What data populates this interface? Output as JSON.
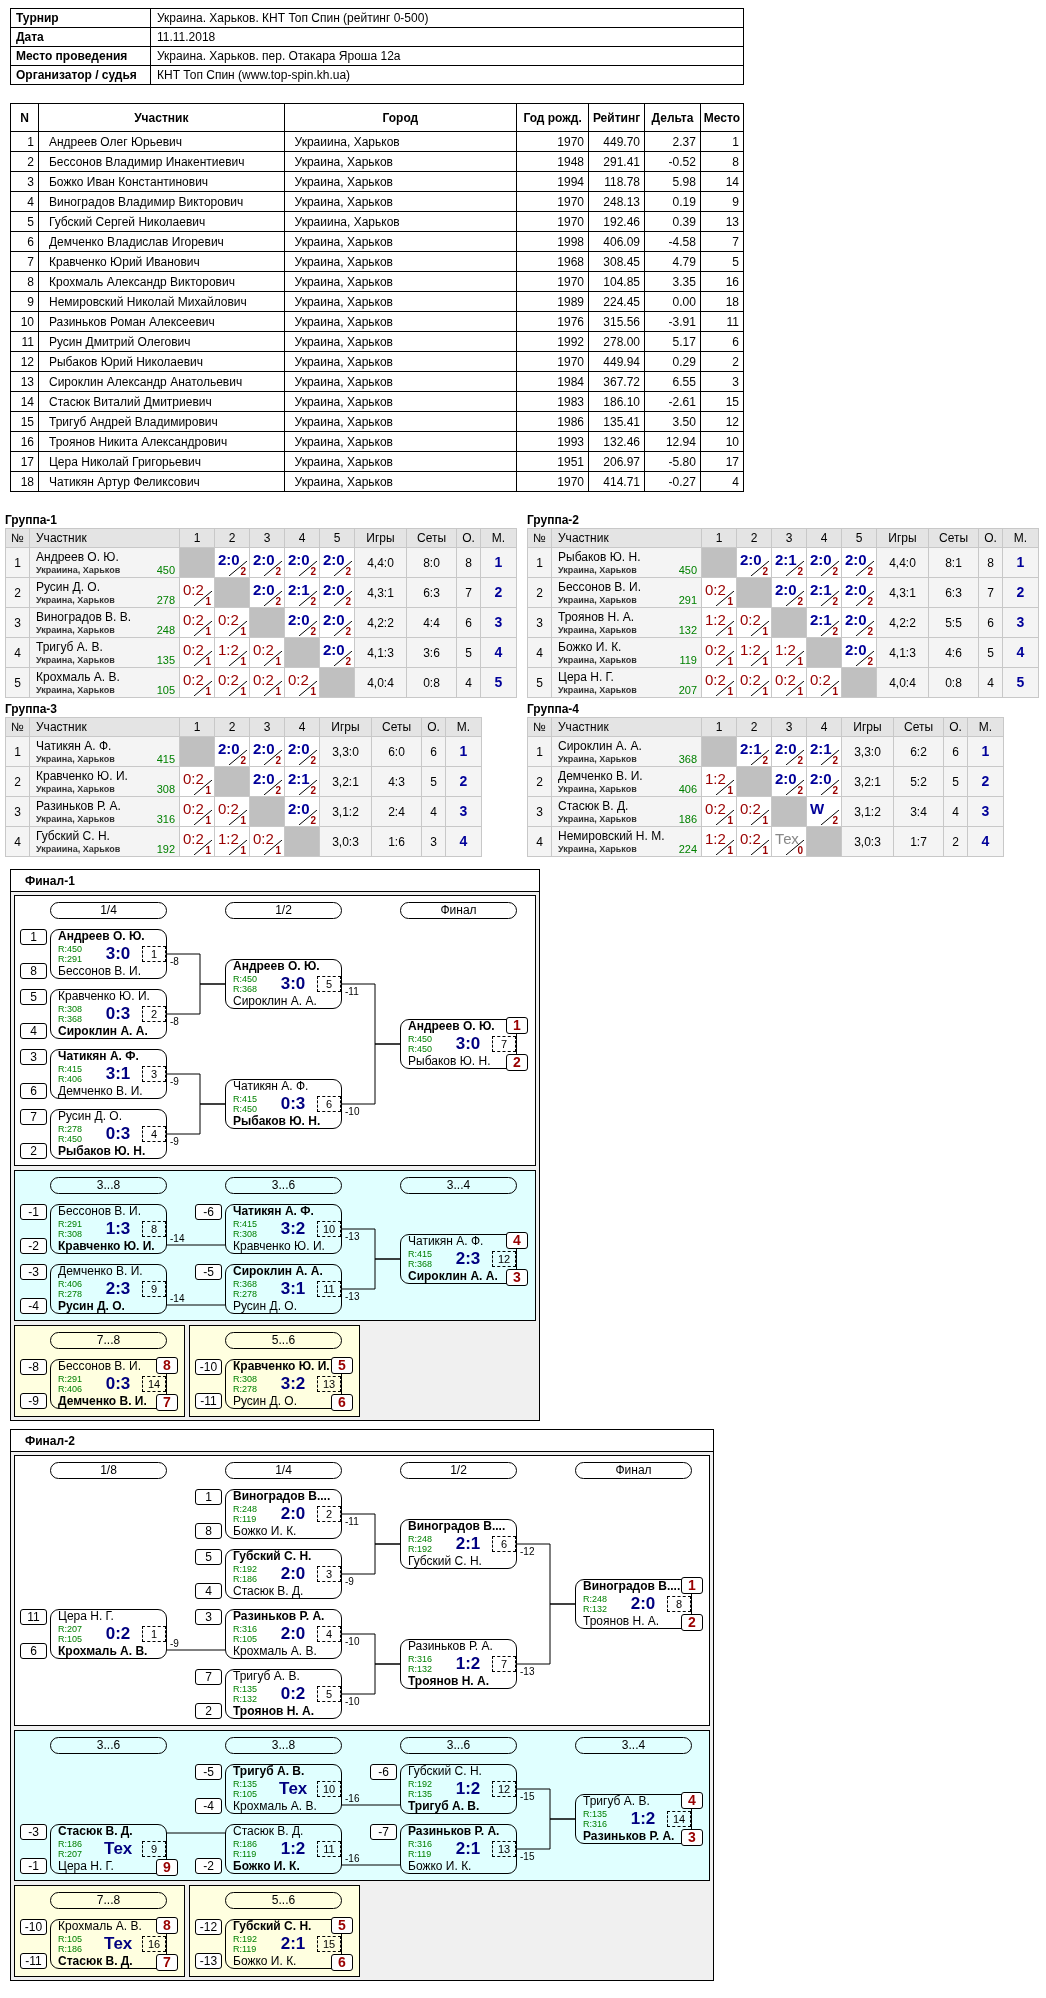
{
  "tournament": [
    {
      "label": "Турнир",
      "value": "Украина. Харьков. КНТ Топ Спин (рейтинг 0-500)"
    },
    {
      "label": "Дата",
      "value": "11.11.2018"
    },
    {
      "label": "Место проведения",
      "value": "Украина. Харьков. пер. Отакара Яроша 12а"
    },
    {
      "label": "Организатор / судья",
      "value": "КНТ Топ Спин (www.top-spin.kh.ua)"
    }
  ],
  "participants": {
    "columns": [
      "N",
      "Участник",
      "Город",
      "Год рожд.",
      "Рейтинг",
      "Дельта",
      "Место"
    ],
    "rows": [
      {
        "n": "1",
        "name": "Андреев Олег Юрьевич",
        "city": "Украиина, Харьков",
        "year": "1970",
        "rating": "449.70",
        "delta": "2.37",
        "place": "1"
      },
      {
        "n": "2",
        "name": "Бессонов Владимир Инакентиевич",
        "city": "Украина, Харьков",
        "year": "1948",
        "rating": "291.41",
        "delta": "-0.52",
        "place": "8"
      },
      {
        "n": "3",
        "name": "Божко Иван Константинович",
        "city": "Украина, Харьков",
        "year": "1994",
        "rating": "118.78",
        "delta": "5.98",
        "place": "14"
      },
      {
        "n": "4",
        "name": "Виноградов Владимир Викторович",
        "city": "Украина, Харьков",
        "year": "1970",
        "rating": "248.13",
        "delta": "0.19",
        "place": "9"
      },
      {
        "n": "5",
        "name": "Губский Сергей Николаевич",
        "city": "Украиина, Харьков",
        "year": "1970",
        "rating": "192.46",
        "delta": "0.39",
        "place": "13"
      },
      {
        "n": "6",
        "name": "Демченко Владислав Игоревич",
        "city": "Украина, Харьков",
        "year": "1998",
        "rating": "406.09",
        "delta": "-4.58",
        "place": "7"
      },
      {
        "n": "7",
        "name": "Кравченко Юрий Иванович",
        "city": "Украина, Харьков",
        "year": "1968",
        "rating": "308.45",
        "delta": "4.79",
        "place": "5"
      },
      {
        "n": "8",
        "name": "Крохмаль Александр Викторович",
        "city": "Украина, Харьков",
        "year": "1970",
        "rating": "104.85",
        "delta": "3.35",
        "place": "16"
      },
      {
        "n": "9",
        "name": "Немировский Николай Михайлович",
        "city": "Украина, Харьков",
        "year": "1989",
        "rating": "224.45",
        "delta": "0.00",
        "place": "18"
      },
      {
        "n": "10",
        "name": "Разиньков Роман Алексеевич",
        "city": "Украина, Харьков",
        "year": "1976",
        "rating": "315.56",
        "delta": "-3.91",
        "place": "11"
      },
      {
        "n": "11",
        "name": "Русин Дмитрий Олегович",
        "city": "Украина, Харьков",
        "year": "1992",
        "rating": "278.00",
        "delta": "5.17",
        "place": "6"
      },
      {
        "n": "12",
        "name": "Рыбаков Юрий Николаевич",
        "city": "Украина, Харьков",
        "year": "1970",
        "rating": "449.94",
        "delta": "0.29",
        "place": "2"
      },
      {
        "n": "13",
        "name": "Сироклин Александр Анатольевич",
        "city": "Украина, Харьков",
        "year": "1984",
        "rating": "367.72",
        "delta": "6.55",
        "place": "3"
      },
      {
        "n": "14",
        "name": "Стасюк Виталий Дмитриевич",
        "city": "Украина, Харьков",
        "year": "1983",
        "rating": "186.10",
        "delta": "-2.61",
        "place": "15"
      },
      {
        "n": "15",
        "name": "Тригуб Андрей Владимирович",
        "city": "Украина, Харьков",
        "year": "1986",
        "rating": "135.41",
        "delta": "3.50",
        "place": "12"
      },
      {
        "n": "16",
        "name": "Троянов Никита Александрович",
        "city": "Украина, Харьков",
        "year": "1993",
        "rating": "132.46",
        "delta": "12.94",
        "place": "10"
      },
      {
        "n": "17",
        "name": "Цера Николай Григорьевич",
        "city": "Украина, Харьков",
        "year": "1951",
        "rating": "206.97",
        "delta": "-5.80",
        "place": "17"
      },
      {
        "n": "18",
        "name": "Чатикян Артур Феликсович",
        "city": "Украина, Харьков",
        "year": "1970",
        "rating": "414.71",
        "delta": "-0.27",
        "place": "4"
      }
    ]
  },
  "groups": [
    {
      "title": "Группа-1",
      "columns": [
        "№",
        "Участник",
        "1",
        "2",
        "3",
        "4",
        "5",
        "Игры",
        "Сеты",
        "О.",
        "М."
      ],
      "rows": [
        {
          "n": "1",
          "name": "Андреев О. Ю.",
          "city": "Украиина, Харьков",
          "rating": "450",
          "results": [
            {
              "kind": "self"
            },
            {
              "kind": "win",
              "score": "2:0",
              "points": "2"
            },
            {
              "kind": "win",
              "score": "2:0",
              "points": "2"
            },
            {
              "kind": "win",
              "score": "2:0",
              "points": "2"
            },
            {
              "kind": "win",
              "score": "2:0",
              "points": "2"
            }
          ],
          "games": "4,4:0",
          "sets": "8:0",
          "points": "8",
          "place": "1"
        },
        {
          "n": "2",
          "name": "Русин Д. О.",
          "city": "Украина, Харьков",
          "rating": "278",
          "results": [
            {
              "kind": "loss",
              "score": "0:2",
              "points": "1"
            },
            {
              "kind": "self"
            },
            {
              "kind": "win",
              "score": "2:0",
              "points": "2"
            },
            {
              "kind": "win",
              "score": "2:1",
              "points": "2"
            },
            {
              "kind": "win",
              "score": "2:0",
              "points": "2"
            }
          ],
          "games": "4,3:1",
          "sets": "6:3",
          "points": "7",
          "place": "2"
        },
        {
          "n": "3",
          "name": "Виноградов В. В.",
          "city": "Украина, Харьков",
          "rating": "248",
          "results": [
            {
              "kind": "loss",
              "score": "0:2",
              "points": "1"
            },
            {
              "kind": "loss",
              "score": "0:2",
              "points": "1"
            },
            {
              "kind": "self"
            },
            {
              "kind": "win",
              "score": "2:0",
              "points": "2"
            },
            {
              "kind": "win",
              "score": "2:0",
              "points": "2"
            }
          ],
          "games": "4,2:2",
          "sets": "4:4",
          "points": "6",
          "place": "3"
        },
        {
          "n": "4",
          "name": "Тригуб А. В.",
          "city": "Украина, Харьков",
          "rating": "135",
          "results": [
            {
              "kind": "loss",
              "score": "0:2",
              "points": "1"
            },
            {
              "kind": "loss",
              "score": "1:2",
              "points": "1"
            },
            {
              "kind": "loss",
              "score": "0:2",
              "points": "1"
            },
            {
              "kind": "self"
            },
            {
              "kind": "win",
              "score": "2:0",
              "points": "2"
            }
          ],
          "games": "4,1:3",
          "sets": "3:6",
          "points": "5",
          "place": "4"
        },
        {
          "n": "5",
          "name": "Крохмаль А. В.",
          "city": "Украина, Харьков",
          "rating": "105",
          "results": [
            {
              "kind": "loss",
              "score": "0:2",
              "points": "1"
            },
            {
              "kind": "loss",
              "score": "0:2",
              "points": "1"
            },
            {
              "kind": "loss",
              "score": "0:2",
              "points": "1"
            },
            {
              "kind": "loss",
              "score": "0:2",
              "points": "1"
            },
            {
              "kind": "self"
            }
          ],
          "games": "4,0:4",
          "sets": "0:8",
          "points": "4",
          "place": "5"
        }
      ]
    },
    {
      "title": "Группа-2",
      "columns": [
        "№",
        "Участник",
        "1",
        "2",
        "3",
        "4",
        "5",
        "Игры",
        "Сеты",
        "О.",
        "М."
      ],
      "rows": [
        {
          "n": "1",
          "name": "Рыбаков Ю. Н.",
          "city": "Украина, Харьков",
          "rating": "450",
          "results": [
            {
              "kind": "self"
            },
            {
              "kind": "win",
              "score": "2:0",
              "points": "2"
            },
            {
              "kind": "win",
              "score": "2:1",
              "points": "2"
            },
            {
              "kind": "win",
              "score": "2:0",
              "points": "2"
            },
            {
              "kind": "win",
              "score": "2:0",
              "points": "2"
            }
          ],
          "games": "4,4:0",
          "sets": "8:1",
          "points": "8",
          "place": "1"
        },
        {
          "n": "2",
          "name": "Бессонов В. И.",
          "city": "Украина, Харьков",
          "rating": "291",
          "results": [
            {
              "kind": "loss",
              "score": "0:2",
              "points": "1"
            },
            {
              "kind": "self"
            },
            {
              "kind": "win",
              "score": "2:0",
              "points": "2"
            },
            {
              "kind": "win",
              "score": "2:1",
              "points": "2"
            },
            {
              "kind": "win",
              "score": "2:0",
              "points": "2"
            }
          ],
          "games": "4,3:1",
          "sets": "6:3",
          "points": "7",
          "place": "2"
        },
        {
          "n": "3",
          "name": "Троянов Н. А.",
          "city": "Украина, Харьков",
          "rating": "132",
          "results": [
            {
              "kind": "loss",
              "score": "1:2",
              "points": "1"
            },
            {
              "kind": "loss",
              "score": "0:2",
              "points": "1"
            },
            {
              "kind": "self"
            },
            {
              "kind": "win",
              "score": "2:1",
              "points": "2"
            },
            {
              "kind": "win",
              "score": "2:0",
              "points": "2"
            }
          ],
          "games": "4,2:2",
          "sets": "5:5",
          "points": "6",
          "place": "3"
        },
        {
          "n": "4",
          "name": "Божко И. К.",
          "city": "Украина, Харьков",
          "rating": "119",
          "results": [
            {
              "kind": "loss",
              "score": "0:2",
              "points": "1"
            },
            {
              "kind": "loss",
              "score": "1:2",
              "points": "1"
            },
            {
              "kind": "loss",
              "score": "1:2",
              "points": "1"
            },
            {
              "kind": "self"
            },
            {
              "kind": "win",
              "score": "2:0",
              "points": "2"
            }
          ],
          "games": "4,1:3",
          "sets": "4:6",
          "points": "5",
          "place": "4"
        },
        {
          "n": "5",
          "name": "Цера Н. Г.",
          "city": "Украина, Харьков",
          "rating": "207",
          "results": [
            {
              "kind": "loss",
              "score": "0:2",
              "points": "1"
            },
            {
              "kind": "loss",
              "score": "0:2",
              "points": "1"
            },
            {
              "kind": "loss",
              "score": "0:2",
              "points": "1"
            },
            {
              "kind": "loss",
              "score": "0:2",
              "points": "1"
            },
            {
              "kind": "self"
            }
          ],
          "games": "4,0:4",
          "sets": "0:8",
          "points": "4",
          "place": "5"
        }
      ]
    },
    {
      "title": "Группа-3",
      "columns": [
        "№",
        "Участник",
        "1",
        "2",
        "3",
        "4",
        "Игры",
        "Сеты",
        "О.",
        "М."
      ],
      "rows": [
        {
          "n": "1",
          "name": "Чатикян А. Ф.",
          "city": "Украина, Харьков",
          "rating": "415",
          "results": [
            {
              "kind": "self"
            },
            {
              "kind": "win",
              "score": "2:0",
              "points": "2"
            },
            {
              "kind": "win",
              "score": "2:0",
              "points": "2"
            },
            {
              "kind": "win",
              "score": "2:0",
              "points": "2"
            }
          ],
          "games": "3,3:0",
          "sets": "6:0",
          "points": "6",
          "place": "1"
        },
        {
          "n": "2",
          "name": "Кравченко Ю. И.",
          "city": "Украина, Харьков",
          "rating": "308",
          "results": [
            {
              "kind": "loss",
              "score": "0:2",
              "points": "1"
            },
            {
              "kind": "self"
            },
            {
              "kind": "win",
              "score": "2:0",
              "points": "2"
            },
            {
              "kind": "win",
              "score": "2:1",
              "points": "2"
            }
          ],
          "games": "3,2:1",
          "sets": "4:3",
          "points": "5",
          "place": "2"
        },
        {
          "n": "3",
          "name": "Разиньков Р. А.",
          "city": "Украина, Харьков",
          "rating": "316",
          "results": [
            {
              "kind": "loss",
              "score": "0:2",
              "points": "1"
            },
            {
              "kind": "loss",
              "score": "0:2",
              "points": "1"
            },
            {
              "kind": "self"
            },
            {
              "kind": "win",
              "score": "2:0",
              "points": "2"
            }
          ],
          "games": "3,1:2",
          "sets": "2:4",
          "points": "4",
          "place": "3"
        },
        {
          "n": "4",
          "name": "Губский С. Н.",
          "city": "Украиина, Харьков",
          "rating": "192",
          "results": [
            {
              "kind": "loss",
              "score": "0:2",
              "points": "1"
            },
            {
              "kind": "loss",
              "score": "1:2",
              "points": "1"
            },
            {
              "kind": "loss",
              "score": "0:2",
              "points": "1"
            },
            {
              "kind": "self"
            }
          ],
          "games": "3,0:3",
          "sets": "1:6",
          "points": "3",
          "place": "4"
        }
      ]
    },
    {
      "title": "Группа-4",
      "columns": [
        "№",
        "Участник",
        "1",
        "2",
        "3",
        "4",
        "Игры",
        "Сеты",
        "О.",
        "М."
      ],
      "rows": [
        {
          "n": "1",
          "name": "Сироклин А. А.",
          "city": "Украина, Харьков",
          "rating": "368",
          "results": [
            {
              "kind": "self"
            },
            {
              "kind": "win",
              "score": "2:1",
              "points": "2"
            },
            {
              "kind": "win",
              "score": "2:0",
              "points": "2"
            },
            {
              "kind": "win",
              "score": "2:1",
              "points": "2"
            }
          ],
          "games": "3,3:0",
          "sets": "6:2",
          "points": "6",
          "place": "1"
        },
        {
          "n": "2",
          "name": "Демченко В. И.",
          "city": "Украина, Харьков",
          "rating": "406",
          "results": [
            {
              "kind": "loss",
              "score": "1:2",
              "points": "1"
            },
            {
              "kind": "self"
            },
            {
              "kind": "win",
              "score": "2:0",
              "points": "2"
            },
            {
              "kind": "win",
              "score": "2:0",
              "points": "2"
            }
          ],
          "games": "3,2:1",
          "sets": "5:2",
          "points": "5",
          "place": "2"
        },
        {
          "n": "3",
          "name": "Стасюк В. Д.",
          "city": "Украина, Харьков",
          "rating": "186",
          "results": [
            {
              "kind": "loss",
              "score": "0:2",
              "points": "1"
            },
            {
              "kind": "loss",
              "score": "0:2",
              "points": "1"
            },
            {
              "kind": "self"
            },
            {
              "kind": "win",
              "score": "W",
              "points": "2"
            }
          ],
          "games": "3,1:2",
          "sets": "3:4",
          "points": "4",
          "place": "3"
        },
        {
          "n": "4",
          "name": "Немировский Н. М.",
          "city": "Украина, Харьков",
          "rating": "224",
          "results": [
            {
              "kind": "loss",
              "score": "1:2",
              "points": "1"
            },
            {
              "kind": "loss",
              "score": "0:2",
              "points": "1"
            },
            {
              "kind": "tech",
              "score": "Тех",
              "points": "0"
            },
            {
              "kind": "self"
            }
          ],
          "games": "3,0:3",
          "sets": "1:7",
          "points": "2",
          "place": "4"
        }
      ]
    }
  ],
  "finals": [
    {
      "title": "Финал-1",
      "sections": [
        {
          "kind": "main",
          "rounds": [
            "1/4",
            "1/2",
            "Финал"
          ],
          "matches": [
            {
              "num": "1",
              "score": "3:0",
              "top_won": true,
              "next": "-8",
              "top": {
                "seed": "1",
                "name": "Андреев О. Ю.",
                "rating": "R:450"
              },
              "bottom": {
                "seed": "8",
                "name": "Бессонов В. И.",
                "rating": "R:291"
              }
            },
            {
              "num": "2",
              "score": "0:3",
              "top_won": false,
              "next": "-8",
              "top": {
                "seed": "5",
                "name": "Кравченко Ю. И.",
                "rating": "R:308"
              },
              "bottom": {
                "seed": "4",
                "name": "Сироклин А. А.",
                "rating": "R:368"
              }
            },
            {
              "num": "3",
              "score": "3:1",
              "top_won": true,
              "next": "-9",
              "top": {
                "seed": "3",
                "name": "Чатикян А. Ф.",
                "rating": "R:415"
              },
              "bottom": {
                "seed": "6",
                "name": "Демченко В. И.",
                "rating": "R:406"
              }
            },
            {
              "num": "4",
              "score": "0:3",
              "top_won": false,
              "next": "-9",
              "top": {
                "seed": "7",
                "name": "Русин Д. О.",
                "rating": "R:278"
              },
              "bottom": {
                "seed": "2",
                "name": "Рыбаков Ю. Н.",
                "rating": "R:450"
              }
            },
            {
              "num": "5",
              "score": "3:0",
              "top_won": true,
              "next": "-11",
              "top": {
                "name": "Андреев О. Ю.",
                "rating": "R:450"
              },
              "bottom": {
                "name": "Сироклин А. А.",
                "rating": "R:368"
              }
            },
            {
              "num": "6",
              "score": "0:3",
              "top_won": false,
              "next": "-10",
              "top": {
                "name": "Чатикян А. Ф.",
                "rating": "R:415"
              },
              "bottom": {
                "name": "Рыбаков Ю. Н.",
                "rating": "R:450"
              }
            },
            {
              "num": "7",
              "score": "3:0",
              "top_won": true,
              "top": {
                "name": "Андреев О. Ю.",
                "rating": "R:450",
                "place": "1"
              },
              "bottom": {
                "name": "Рыбаков Ю. Н.",
                "rating": "R:450",
                "place": "2"
              }
            }
          ]
        },
        {
          "kind": "consolation",
          "rounds": [
            "3...8",
            "3...6",
            "3...4"
          ],
          "matches": [
            {
              "num": "8",
              "score": "1:3",
              "top_won": false,
              "next": "-14",
              "top": {
                "seed": "-1",
                "name": "Бессонов В. И.",
                "rating": "R:291"
              },
              "bottom": {
                "seed": "-2",
                "name": "Кравченко Ю. И.",
                "rating": "R:308"
              }
            },
            {
              "num": "9",
              "score": "2:3",
              "top_won": false,
              "next": "-14",
              "top": {
                "seed": "-3",
                "name": "Демченко В. И.",
                "rating": "R:406"
              },
              "bottom": {
                "seed": "-4",
                "name": "Русин Д. О.",
                "rating": "R:278"
              }
            },
            {
              "num": "10",
              "score": "3:2",
              "top_won": true,
              "next": "-13",
              "top": {
                "seed": "-6",
                "name": "Чатикян А. Ф.",
                "rating": "R:415"
              },
              "bottom": {
                "name": "Кравченко Ю. И.",
                "rating": "R:308"
              }
            },
            {
              "num": "11",
              "score": "3:1",
              "top_won": true,
              "next": "-13",
              "top": {
                "seed": "-5",
                "name": "Сироклин А. А.",
                "rating": "R:368"
              },
              "bottom": {
                "name": "Русин Д. О.",
                "rating": "R:278"
              }
            },
            {
              "num": "12",
              "score": "2:3",
              "top_won": false,
              "top": {
                "name": "Чатикян А. Ф.",
                "rating": "R:415",
                "place": "4"
              },
              "bottom": {
                "name": "Сироклин А. А.",
                "rating": "R:368",
                "place": "3"
              }
            }
          ]
        },
        {
          "kind": "placement",
          "rounds": [
            "7...8"
          ],
          "matches": [
            {
              "num": "14",
              "score": "0:3",
              "top_won": false,
              "top": {
                "seed": "-8",
                "name": "Бессонов В. И.",
                "rating": "R:291",
                "place": "8"
              },
              "bottom": {
                "seed": "-9",
                "name": "Демченко В. И.",
                "rating": "R:406",
                "place": "7"
              }
            }
          ]
        },
        {
          "kind": "placement",
          "rounds": [
            "5...6"
          ],
          "matches": [
            {
              "num": "13",
              "score": "3:2",
              "top_won": true,
              "top": {
                "seed": "-10",
                "name": "Кравченко Ю. И.",
                "rating": "R:308",
                "place": "5"
              },
              "bottom": {
                "seed": "-11",
                "name": "Русин Д. О.",
                "rating": "R:278",
                "place": "6"
              }
            }
          ]
        }
      ]
    },
    {
      "title": "Финал-2",
      "sections": [
        {
          "kind": "main",
          "rounds": [
            "1/8",
            "1/4",
            "1/2",
            "Финал"
          ],
          "matches": [
            {
              "num": "1",
              "score": "0:2",
              "top_won": false,
              "next": "-9",
              "top": {
                "seed": "11",
                "name": "Цера Н. Г.",
                "rating": "R:207"
              },
              "bottom": {
                "seed": "6",
                "name": "Крохмаль А. В.",
                "rating": "R:105"
              }
            },
            {
              "num": "2",
              "score": "2:0",
              "top_won": true,
              "next": "-11",
              "top": {
                "seed": "1",
                "name": "Виноградов В....",
                "rating": "R:248"
              },
              "bottom": {
                "seed": "8",
                "name": "Божко И. К.",
                "rating": "R:119"
              }
            },
            {
              "num": "3",
              "score": "2:0",
              "top_won": true,
              "next": "-9",
              "top": {
                "seed": "5",
                "name": "Губский С. Н.",
                "rating": "R:192"
              },
              "bottom": {
                "seed": "4",
                "name": "Стасюк В. Д.",
                "rating": "R:186"
              }
            },
            {
              "num": "4",
              "score": "2:0",
              "top_won": true,
              "next": "-10",
              "top": {
                "seed": "3",
                "name": "Разиньков Р. А.",
                "rating": "R:316"
              },
              "bottom": {
                "name": "Крохмаль А. В.",
                "rating": "R:105"
              }
            },
            {
              "num": "5",
              "score": "0:2",
              "top_won": false,
              "next": "-10",
              "top": {
                "seed": "7",
                "name": "Тригуб А. В.",
                "rating": "R:135"
              },
              "bottom": {
                "seed": "2",
                "name": "Троянов Н. А.",
                "rating": "R:132"
              }
            },
            {
              "num": "6",
              "score": "2:1",
              "top_won": true,
              "next": "-12",
              "top": {
                "name": "Виноградов В....",
                "rating": "R:248"
              },
              "bottom": {
                "name": "Губский С. Н.",
                "rating": "R:192"
              }
            },
            {
              "num": "7",
              "score": "1:2",
              "top_won": false,
              "next": "-13",
              "top": {
                "name": "Разиньков Р. А.",
                "rating": "R:316"
              },
              "bottom": {
                "name": "Троянов Н. А.",
                "rating": "R:132"
              }
            },
            {
              "num": "8",
              "score": "2:0",
              "top_won": true,
              "top": {
                "name": "Виноградов В....",
                "rating": "R:248",
                "place": "1"
              },
              "bottom": {
                "name": "Троянов Н. А.",
                "rating": "R:132",
                "place": "2"
              }
            }
          ]
        },
        {
          "kind": "consolation",
          "rounds": [
            "3...6",
            "3...8",
            "3...6",
            "3...4"
          ],
          "matches": [
            {
              "num": "9",
              "score": "Тех",
              "top_won": true,
              "top": {
                "seed": "-3",
                "name": "Стасюк В. Д.",
                "rating": "R:186"
              },
              "bottom": {
                "seed": "-1",
                "name": "Цера Н. Г.",
                "rating": "R:207",
                "place": "9"
              }
            },
            {
              "num": "10",
              "score": "Тех",
              "top_won": true,
              "next": "-16",
              "top": {
                "seed": "-5",
                "name": "Тригуб А. В.",
                "rating": "R:135"
              },
              "bottom": {
                "seed": "-4",
                "name": "Крохмаль А. В.",
                "rating": "R:105"
              }
            },
            {
              "num": "11",
              "score": "1:2",
              "top_won": false,
              "next": "-16",
              "top": {
                "name": "Стасюк В. Д.",
                "rating": "R:186"
              },
              "bottom": {
                "seed": "-2",
                "name": "Божко И. К.",
                "rating": "R:119"
              }
            },
            {
              "num": "12",
              "score": "1:2",
              "top_won": false,
              "next": "-15",
              "top": {
                "seed": "-6",
                "name": "Губский С. Н.",
                "rating": "R:192"
              },
              "bottom": {
                "name": "Тригуб А. В.",
                "rating": "R:135"
              }
            },
            {
              "num": "13",
              "score": "2:1",
              "top_won": true,
              "next": "-15",
              "top": {
                "seed": "-7",
                "name": "Разиньков Р. А.",
                "rating": "R:316"
              },
              "bottom": {
                "name": "Божко И. К.",
                "rating": "R:119"
              }
            },
            {
              "num": "14",
              "score": "1:2",
              "top_won": false,
              "top": {
                "name": "Тригуб А. В.",
                "rating": "R:135",
                "place": "4"
              },
              "bottom": {
                "name": "Разиньков Р. А.",
                "rating": "R:316",
                "place": "3"
              }
            }
          ]
        },
        {
          "kind": "placement",
          "rounds": [
            "7...8"
          ],
          "matches": [
            {
              "num": "16",
              "score": "Тех",
              "top_won": false,
              "top": {
                "seed": "-10",
                "name": "Крохмаль А. В.",
                "rating": "R:105",
                "place": "8"
              },
              "bottom": {
                "seed": "-11",
                "name": "Стасюк В. Д.",
                "rating": "R:186",
                "place": "7"
              }
            }
          ]
        },
        {
          "kind": "placement",
          "rounds": [
            "5...6"
          ],
          "matches": [
            {
              "num": "15",
              "score": "2:1",
              "top_won": true,
              "top": {
                "seed": "-12",
                "name": "Губский С. Н.",
                "rating": "R:192",
                "place": "5"
              },
              "bottom": {
                "seed": "-13",
                "name": "Божко И. К.",
                "rating": "R:119",
                "place": "6"
              }
            }
          ]
        }
      ]
    }
  ]
}
